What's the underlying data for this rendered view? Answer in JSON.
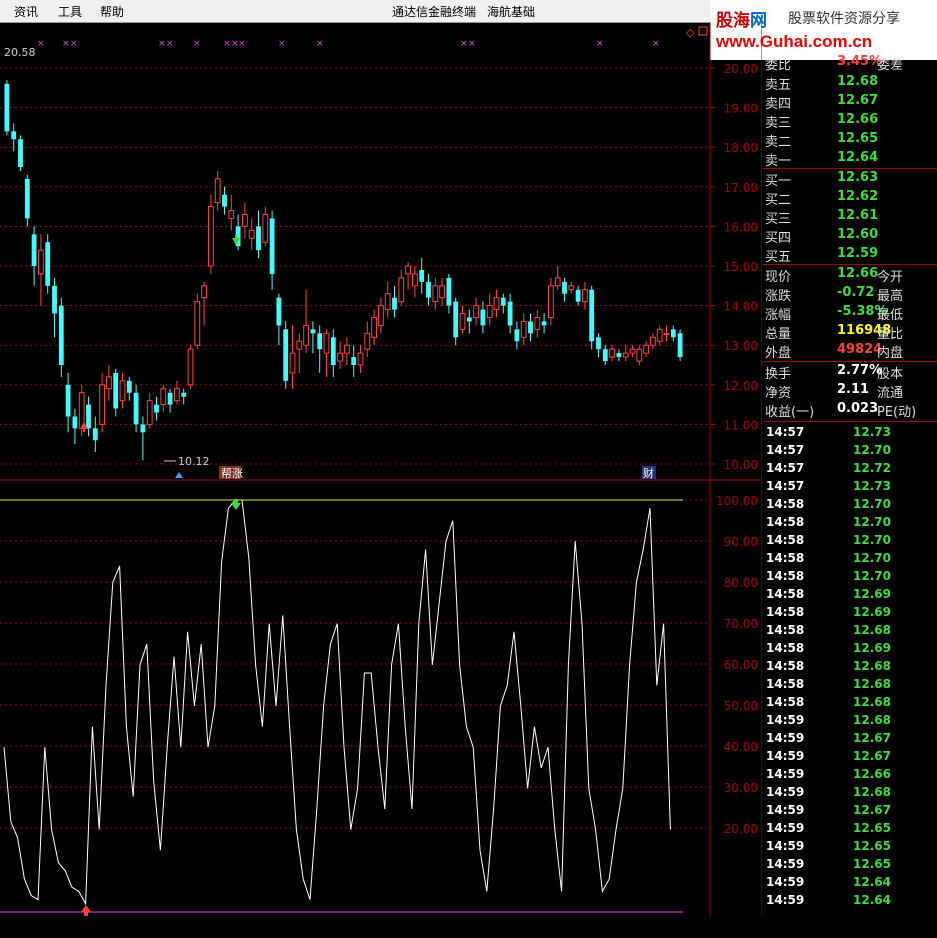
{
  "menu": {
    "items": [
      "资讯",
      "工具",
      "帮助"
    ],
    "title": "通达信金融终端",
    "title2": "海航基础"
  },
  "logo": {
    "name_part1": "股海",
    "name_part2": "网",
    "slogan": "股票软件资源分享",
    "url": "www.Guhai.com.cn"
  },
  "price_axis": {
    "ticks": [
      "20.00",
      "19.00",
      "18.00",
      "17.00",
      "16.00",
      "15.00",
      "14.00",
      "13.00",
      "12.00",
      "11.00",
      "10.00"
    ],
    "top_value": "20.58",
    "low_annotation": "10.12"
  },
  "indicator_axis": {
    "ticks": [
      "100.00",
      "90.00",
      "80.00",
      "70.00",
      "60.00",
      "50.00",
      "40.00",
      "30.00",
      "20.00"
    ]
  },
  "markers": {
    "signal_tag": "帮涨",
    "finance_tag": "财"
  },
  "order_book": {
    "weibi": {
      "label": "委比",
      "value": "3.45%",
      "label2": "委差"
    },
    "asks": [
      {
        "label": "卖五",
        "price": "12.68"
      },
      {
        "label": "卖四",
        "price": "12.67"
      },
      {
        "label": "卖三",
        "price": "12.66"
      },
      {
        "label": "卖二",
        "price": "12.65"
      },
      {
        "label": "卖一",
        "price": "12.64"
      }
    ],
    "bids": [
      {
        "label": "买一",
        "price": "12.63"
      },
      {
        "label": "买二",
        "price": "12.62"
      },
      {
        "label": "买三",
        "price": "12.61"
      },
      {
        "label": "买四",
        "price": "12.60"
      },
      {
        "label": "买五",
        "price": "12.59"
      }
    ]
  },
  "quote": [
    {
      "label": "现价",
      "value": "12.66",
      "label2": "今开",
      "color": "dn"
    },
    {
      "label": "涨跌",
      "value": "-0.72",
      "label2": "最高",
      "color": "dn"
    },
    {
      "label": "涨幅",
      "value": "-5.38%",
      "label2": "最低",
      "color": "dn"
    },
    {
      "label": "总量",
      "value": "116948",
      "label2": "量比",
      "color": "yel"
    },
    {
      "label": "外盘",
      "value": "49824",
      "label2": "内盘",
      "color": "up"
    }
  ],
  "stats": [
    {
      "label": "换手",
      "value": "2.77%",
      "label2": "股本"
    },
    {
      "label": "净资",
      "value": "2.11",
      "label2": "流通"
    },
    {
      "label": "收益(一)",
      "value": "0.023",
      "label2": "PE(动)"
    }
  ],
  "ticks": [
    {
      "time": "14:57",
      "price": "12.73"
    },
    {
      "time": "14:57",
      "price": "12.70"
    },
    {
      "time": "14:57",
      "price": "12.72"
    },
    {
      "time": "14:57",
      "price": "12.73"
    },
    {
      "time": "14:58",
      "price": "12.70"
    },
    {
      "time": "14:58",
      "price": "12.70"
    },
    {
      "time": "14:58",
      "price": "12.70"
    },
    {
      "time": "14:58",
      "price": "12.70"
    },
    {
      "time": "14:58",
      "price": "12.70"
    },
    {
      "time": "14:58",
      "price": "12.69"
    },
    {
      "time": "14:58",
      "price": "12.69"
    },
    {
      "time": "14:58",
      "price": "12.68"
    },
    {
      "time": "14:58",
      "price": "12.69"
    },
    {
      "time": "14:58",
      "price": "12.68"
    },
    {
      "time": "14:58",
      "price": "12.68"
    },
    {
      "time": "14:58",
      "price": "12.68"
    },
    {
      "time": "14:59",
      "price": "12.68"
    },
    {
      "time": "14:59",
      "price": "12.67"
    },
    {
      "time": "14:59",
      "price": "12.67"
    },
    {
      "time": "14:59",
      "price": "12.66"
    },
    {
      "time": "14:59",
      "price": "12.68"
    },
    {
      "time": "14:59",
      "price": "12.67"
    },
    {
      "time": "14:59",
      "price": "12.65"
    },
    {
      "time": "14:59",
      "price": "12.65"
    },
    {
      "time": "14:59",
      "price": "12.65"
    },
    {
      "time": "14:59",
      "price": "12.64"
    },
    {
      "time": "14:59",
      "price": "12.64"
    }
  ],
  "colors": {
    "up": "#ff4040",
    "down": "#40ffff",
    "grid": "#a00000",
    "line": "#ffffff"
  }
}
